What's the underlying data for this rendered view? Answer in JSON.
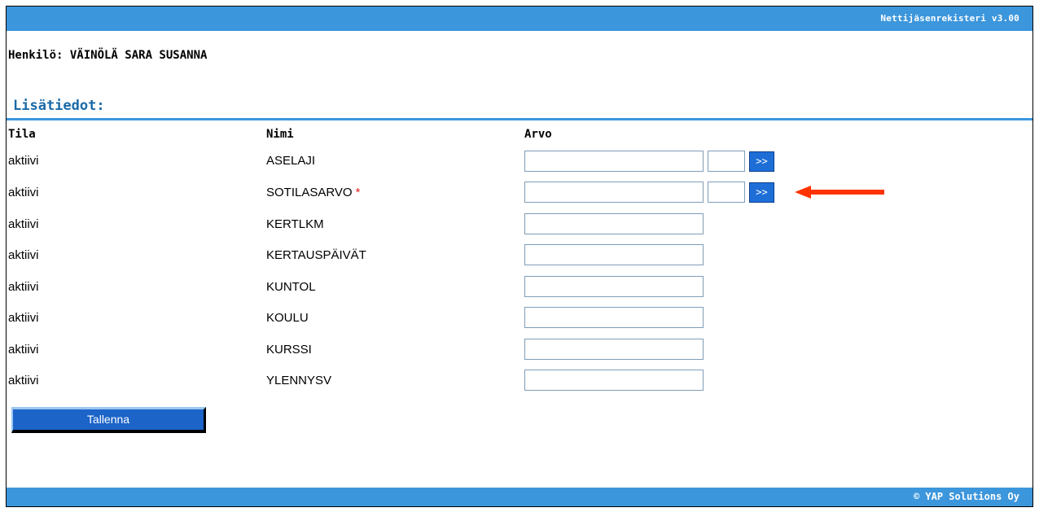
{
  "header": {
    "app_title": "Nettijäsenrekisteri v3.00"
  },
  "person": {
    "label": "Henkilö: VÄINÖLÄ SARA SUSANNA"
  },
  "section": {
    "title": "Lisätiedot:"
  },
  "table": {
    "columns": [
      "Tila",
      "Nimi",
      "Arvo"
    ],
    "rows": [
      {
        "tila": "aktiivi",
        "nimi": "ASELAJI",
        "required": false,
        "lookup": true,
        "value": ""
      },
      {
        "tila": "aktiivi",
        "nimi": "SOTILASARVO",
        "required": true,
        "required_mark": "*",
        "lookup": true,
        "value": ""
      },
      {
        "tila": "aktiivi",
        "nimi": "KERTLKM",
        "required": false,
        "lookup": false,
        "value": ""
      },
      {
        "tila": "aktiivi",
        "nimi": "KERTAUSPÄIVÄT",
        "required": false,
        "lookup": false,
        "value": ""
      },
      {
        "tila": "aktiivi",
        "nimi": "KUNTOL",
        "required": false,
        "lookup": false,
        "value": ""
      },
      {
        "tila": "aktiivi",
        "nimi": "KOULU",
        "required": false,
        "lookup": false,
        "value": ""
      },
      {
        "tila": "aktiivi",
        "nimi": "KURSSI",
        "required": false,
        "lookup": false,
        "value": ""
      },
      {
        "tila": "aktiivi",
        "nimi": "YLENNYSV",
        "required": false,
        "lookup": false,
        "value": ""
      }
    ],
    "lookup_button_label": ">>"
  },
  "actions": {
    "save_label": "Tallenna"
  },
  "footer": {
    "text": "© YAP Solutions Oy"
  },
  "colors": {
    "bar": "#3c96dc",
    "section_title": "#1a6aa8",
    "button": "#1c64c8",
    "required": "#e02020",
    "annotation_arrow": "#ff3300"
  },
  "annotation": {
    "icon": "left-arrow-icon",
    "points_to_row": "SOTILASARVO"
  }
}
